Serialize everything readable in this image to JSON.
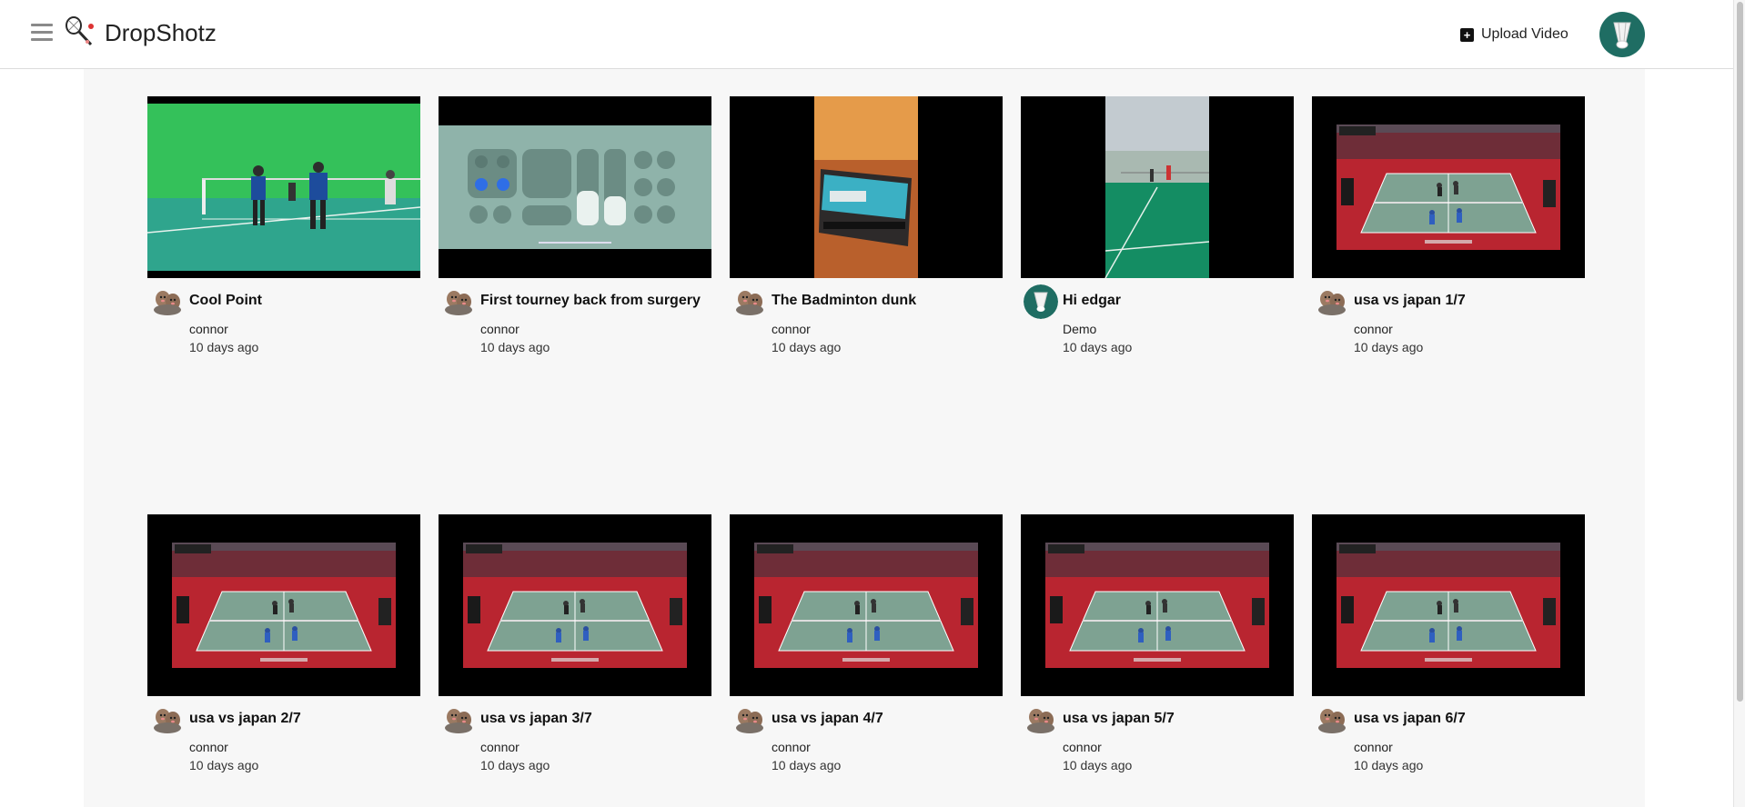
{
  "app": {
    "title": "DropShotz"
  },
  "header": {
    "upload_label": "Upload Video"
  },
  "colors": {
    "accent": "#1f6d63",
    "court_red": "#c8242e",
    "court_green": "#5f8f7c"
  },
  "videos": [
    {
      "title": "Cool Point",
      "author": "connor",
      "time": "10 days ago",
      "thumb": "green-room",
      "avatar": "rock"
    },
    {
      "title": "First tourney back from surgery",
      "author": "connor",
      "time": "10 days ago",
      "thumb": "control-center",
      "avatar": "rock"
    },
    {
      "title": "The Badminton dunk",
      "author": "connor",
      "time": "10 days ago",
      "thumb": "phone-vertical",
      "avatar": "rock"
    },
    {
      "title": "Hi edgar",
      "author": "Demo",
      "time": "10 days ago",
      "thumb": "gym-vertical",
      "avatar": "shuttlecock"
    },
    {
      "title": "usa vs japan 1/7",
      "author": "connor",
      "time": "10 days ago",
      "thumb": "tournament",
      "avatar": "rock"
    },
    {
      "title": "usa vs japan 2/7",
      "author": "connor",
      "time": "10 days ago",
      "thumb": "tournament",
      "avatar": "rock"
    },
    {
      "title": "usa vs japan 3/7",
      "author": "connor",
      "time": "10 days ago",
      "thumb": "tournament",
      "avatar": "rock"
    },
    {
      "title": "usa vs japan 4/7",
      "author": "connor",
      "time": "10 days ago",
      "thumb": "tournament",
      "avatar": "rock"
    },
    {
      "title": "usa vs japan 5/7",
      "author": "connor",
      "time": "10 days ago",
      "thumb": "tournament",
      "avatar": "rock"
    },
    {
      "title": "usa vs japan 6/7",
      "author": "connor",
      "time": "10 days ago",
      "thumb": "tournament",
      "avatar": "rock"
    }
  ]
}
